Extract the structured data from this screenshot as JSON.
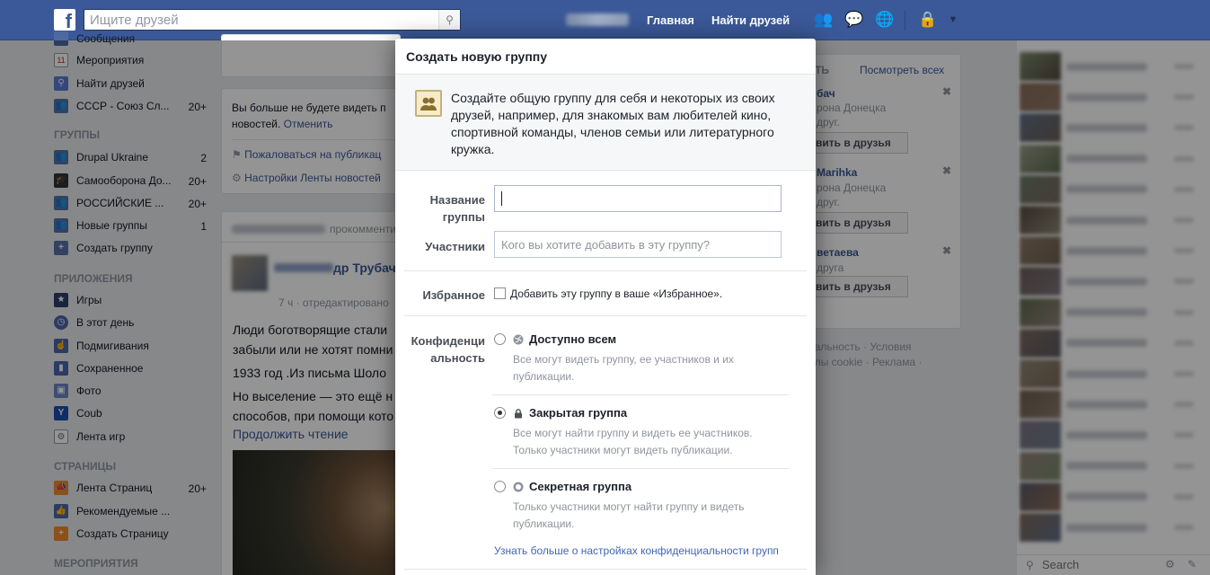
{
  "topbar": {
    "search_placeholder": "Ищите друзей",
    "nav_home": "Главная",
    "nav_find_friends": "Найти друзей"
  },
  "left_nav": {
    "top_cut_label": "Сообщения",
    "items_top": [
      {
        "label": "Мероприятия",
        "icon": "calendar-icon",
        "count": ""
      },
      {
        "label": "Найти друзей",
        "icon": "find-friends-icon",
        "count": ""
      },
      {
        "label": "СССР - Союз Сл...",
        "icon": "group-icon",
        "count": "20+"
      }
    ],
    "groups_header": "ГРУППЫ",
    "groups": [
      {
        "label": "Drupal Ukraine",
        "icon": "group-icon",
        "count": "2"
      },
      {
        "label": "Самооборона До...",
        "icon": "graduation-cap-icon",
        "count": "20+"
      },
      {
        "label": "РОССИЙСКИЕ ...",
        "icon": "group-icon",
        "count": "20+"
      },
      {
        "label": "Новые группы",
        "icon": "group-icon",
        "count": "1"
      },
      {
        "label": "Создать группу",
        "icon": "create-group-icon",
        "count": ""
      }
    ],
    "apps_header": "ПРИЛОЖЕНИЯ",
    "apps": [
      {
        "label": "Игры",
        "icon": "games-icon"
      },
      {
        "label": "В этот день",
        "icon": "clock-icon"
      },
      {
        "label": "Подмигивания",
        "icon": "poke-icon"
      },
      {
        "label": "Сохраненное",
        "icon": "bookmark-icon"
      },
      {
        "label": "Фото",
        "icon": "photo-icon"
      },
      {
        "label": "Coub",
        "icon": "coub-icon"
      },
      {
        "label": "Лента игр",
        "icon": "gamepad-icon"
      }
    ],
    "pages_header": "СТРАНИЦЫ",
    "pages": [
      {
        "label": "Лента Страниц",
        "icon": "megaphone-icon",
        "count": "20+"
      },
      {
        "label": "Рекомендуемые ...",
        "icon": "thumbs-up-icon",
        "count": ""
      },
      {
        "label": "Создать Страницу",
        "icon": "create-page-icon",
        "count": ""
      }
    ],
    "events_header": "МЕРОПРИЯТИЯ"
  },
  "feed": {
    "hidden_line1": "Вы больше не будете видеть п",
    "hidden_line2": "новостей.",
    "undo_link": "Отменить",
    "report_link": "Пожаловаться на публикац",
    "settings_link": "Настройки Ленты новостей",
    "commented": "прокомменти",
    "author_tail": "др Трубач",
    "post_meta": "7 ч · отредактировано",
    "line1": "Люди боготворящие стали",
    "line2": "забыли или не хотят помни",
    "line3": "1933 год .Из письма Шоло",
    "line4": "Но выселение — это ещё н",
    "line5": "способов, при помощи кото",
    "read_more": "Продолжить чтение"
  },
  "right_panel": {
    "see_all": "Посмотреть всех",
    "header_tail": "АТЬ",
    "suggestions": [
      {
        "name": "бач",
        "sub1": "рона Донецка",
        "sub2": "друг.",
        "button": "вить в друзья"
      },
      {
        "name": "Marihka",
        "sub1": "рона Донецка",
        "sub2": "друг.",
        "button": "вить в друзья"
      },
      {
        "name": "ветаева",
        "sub1": "",
        "sub2": "друга",
        "button": "вить в друзья"
      }
    ],
    "footer_line1": "иальность · Условия",
    "footer_line2": "йлы cookie · Реклама ·"
  },
  "chat": {
    "search_placeholder": "Search"
  },
  "modal": {
    "title": "Создать новую группу",
    "intro": "Создайте общую группу для себя и некоторых из своих друзей, например, для знакомых вам любителей кино, спортивной команды, членов семьи или литературного кружка.",
    "name_label_1": "Название",
    "name_label_2": "группы",
    "name_value": "",
    "members_label": "Участники",
    "members_placeholder": "Кого вы хотите добавить в эту группу?",
    "favorites_label": "Избранное",
    "favorites_checkbox": "Добавить эту группу в ваше «Избранное».",
    "privacy_label_1": "Конфиденци",
    "privacy_label_2": "альность",
    "options": [
      {
        "title": "Доступно всем",
        "desc1": "Все могут видеть группу, ее участников и их",
        "desc2": "публикации.",
        "icon": "globe-icon",
        "selected": false
      },
      {
        "title": "Закрытая группа",
        "desc1": "Все могут найти группу и видеть ее участников.",
        "desc2": "Только участники могут видеть публикации.",
        "icon": "lock-icon",
        "selected": true
      },
      {
        "title": "Секретная группа",
        "desc1": "Только участники могут найти группу и видеть",
        "desc2": "публикации.",
        "icon": "secret-icon",
        "selected": false
      }
    ],
    "learn_more": "Узнать больше о настройках конфиденциальности групп"
  }
}
